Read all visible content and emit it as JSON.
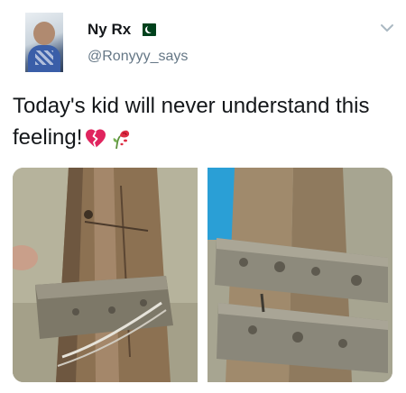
{
  "tweet": {
    "author": {
      "display_name": "Ny Rx",
      "handle": "@Ronyyy_says",
      "flag_icon": "pakistan-flag-icon"
    },
    "text": "Today's kid will never understand this feeling!",
    "emojis": [
      "broken-heart-icon",
      "wilted-rose-icon"
    ],
    "menu_icon": "chevron-down-icon",
    "media": [
      {
        "name": "left-photo",
        "icon": "wooden-cricket-stumps-photo"
      },
      {
        "name": "right-photo",
        "icon": "wooden-post-with-metal-plates-photo"
      }
    ]
  },
  "colors": {
    "text": "#14171a",
    "secondary_text": "#657786",
    "broken_heart": "#e0245e",
    "flag_green": "#01411c"
  }
}
